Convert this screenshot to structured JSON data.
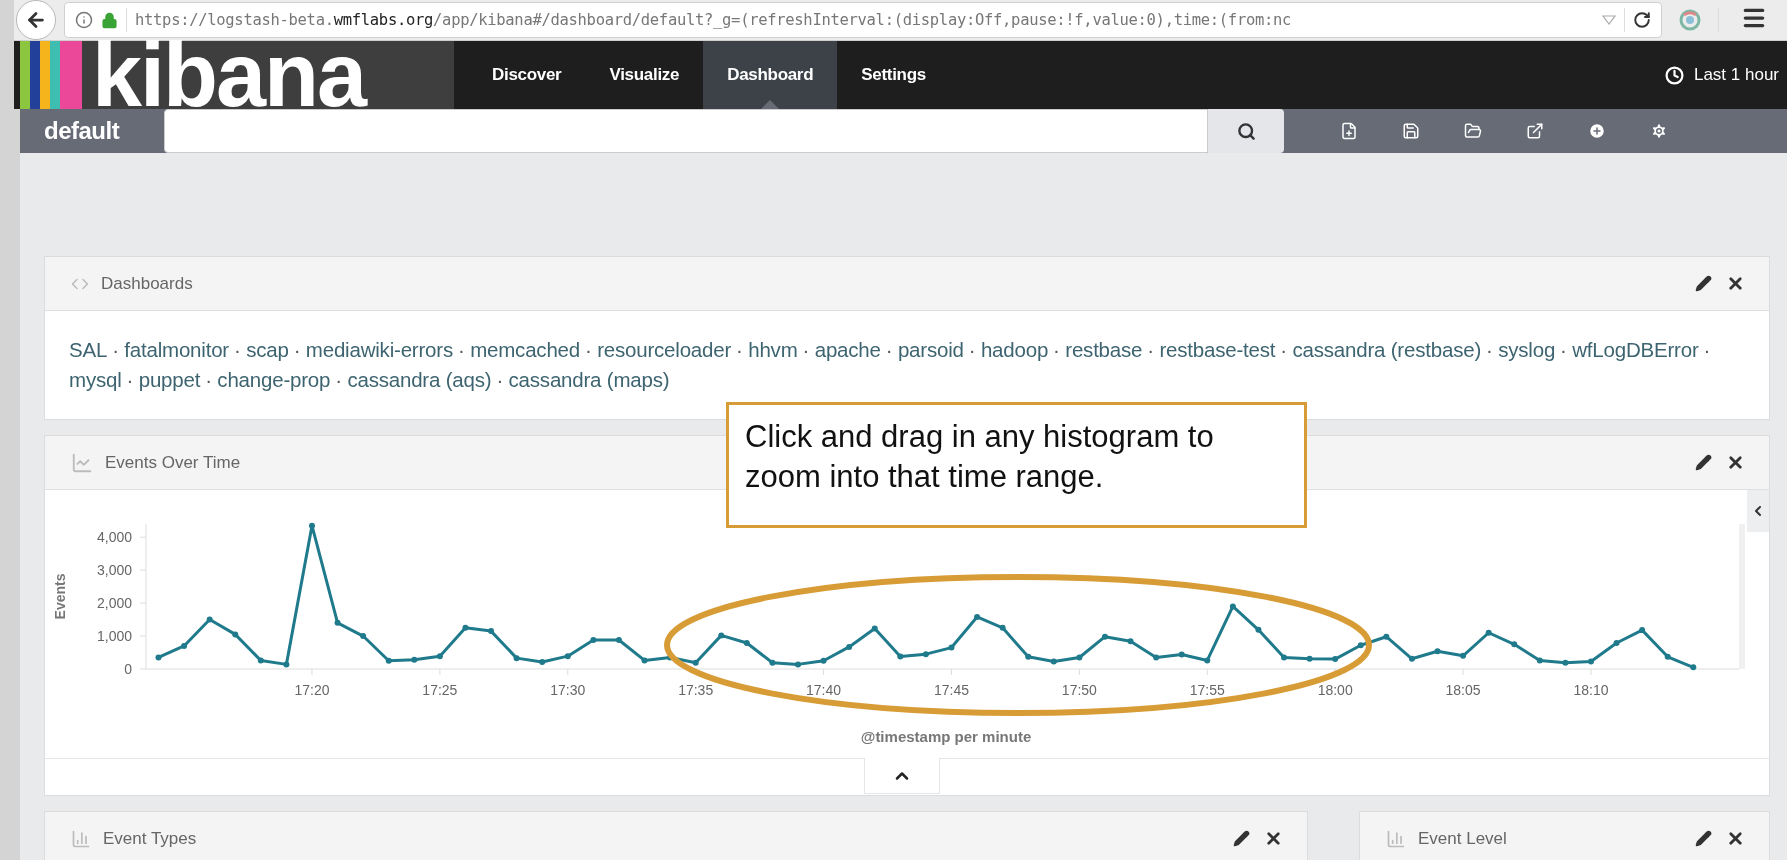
{
  "browser": {
    "url": [
      {
        "text": "https://logstash-beta.",
        "emphasis": false
      },
      {
        "text": "wmflabs.org",
        "emphasis": true
      },
      {
        "text": "/app/kibana#/dashboard/default?_g=(refreshInterval:(display:Off,pause:!f,value:0),time:(from:nc",
        "emphasis": false
      }
    ]
  },
  "app": {
    "logo": "kibana",
    "nav": [
      {
        "label": "Discover",
        "selected": false
      },
      {
        "label": "Visualize",
        "selected": false
      },
      {
        "label": "Dashboard",
        "selected": true
      },
      {
        "label": "Settings",
        "selected": false
      }
    ],
    "time_picker": "Last 1 hour"
  },
  "query_bar": {
    "dashboard_name": "default"
  },
  "panels": [
    {
      "kind": "links",
      "title": "Dashboards",
      "separator": "·",
      "links": [
        "SAL",
        "fatalmonitor",
        "scap",
        "mediawiki-errors",
        "memcached",
        "resourceloader",
        "hhvm",
        "apache",
        "parsoid",
        "hadoop",
        "restbase",
        "restbase-test",
        "cassandra (restbase)",
        "syslog",
        "wfLogDBError",
        "mysql",
        "puppet",
        "change-prop",
        "cassandra (aqs)",
        "cassandra (maps)"
      ]
    },
    {
      "kind": "chart",
      "title": "Events Over Time",
      "chart_data": {
        "type": "line",
        "xlabel": "@timestamp per minute",
        "ylabel": "Events",
        "categories": [
          null,
          null,
          null,
          null,
          null,
          null,
          "17:20",
          null,
          null,
          null,
          null,
          "17:25",
          null,
          null,
          null,
          null,
          "17:30",
          null,
          null,
          null,
          null,
          "17:35",
          null,
          null,
          null,
          null,
          "17:40",
          null,
          null,
          null,
          null,
          "17:45",
          null,
          null,
          null,
          null,
          "17:50",
          null,
          null,
          null,
          null,
          "17:55",
          null,
          null,
          null,
          null,
          "18:00",
          null,
          null,
          null,
          null,
          "18:05",
          null,
          null,
          null,
          null,
          "18:10",
          null,
          null,
          null,
          null
        ],
        "series": [
          {
            "color": "#1f7a8c",
            "marker": true,
            "values": [
              350,
              700,
              1500,
              1050,
              260,
              140,
              4350,
              1400,
              1000,
              250,
              280,
              390,
              1250,
              1150,
              330,
              210,
              390,
              880,
              880,
              260,
              350,
              190,
              1020,
              790,
              190,
              140,
              250,
              670,
              1230,
              380,
              450,
              650,
              1580,
              1250,
              370,
              230,
              350,
              980,
              840,
              350,
              440,
              260,
              1900,
              1190,
              350,
              310,
              300,
              720,
              980,
              310,
              540,
              400,
              1100,
              750,
              260,
              190,
              230,
              790,
              1180,
              370,
              50
            ]
          }
        ],
        "ylim": [
          0,
          4400
        ],
        "yticks": [
          {
            "value": 0,
            "label": "0"
          },
          {
            "value": 1000,
            "label": "1,000"
          },
          {
            "value": 2000,
            "label": "2,000"
          },
          {
            "value": 3000,
            "label": "3,000"
          },
          {
            "value": 4000,
            "label": "4,000"
          }
        ]
      }
    }
  ],
  "bottom_panels": [
    {
      "title": "Event Types"
    },
    {
      "title": "Event Level"
    }
  ],
  "callout": {
    "text": "Click and drag in any histogram to zoom into that time range."
  }
}
